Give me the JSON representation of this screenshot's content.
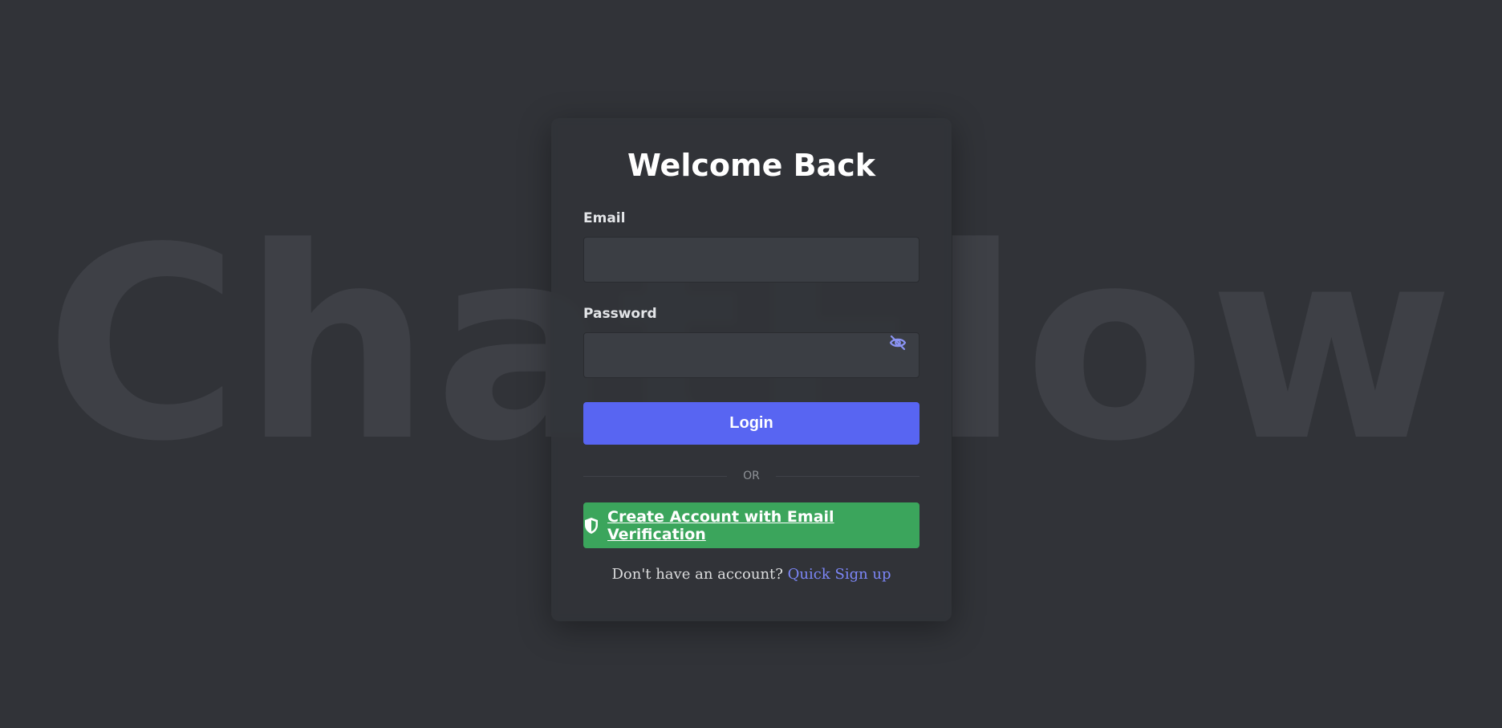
{
  "background": {
    "word": "ChatFlow"
  },
  "card": {
    "title": "Welcome Back"
  },
  "email": {
    "label": "Email",
    "value": "",
    "placeholder": ""
  },
  "password": {
    "label": "Password",
    "value": "",
    "placeholder": "",
    "toggle_icon": "eye-slash-icon"
  },
  "login_button": {
    "label": "Login"
  },
  "divider": {
    "text": "OR"
  },
  "verify_button": {
    "label": "Create Account with Email Verification",
    "icon": "shield-icon"
  },
  "signup": {
    "prompt": "Don't have an account?",
    "link": "Quick Sign up"
  },
  "colors": {
    "background": "#313338",
    "card": "#313338",
    "input": "#3b3e44",
    "primary": "#5865f2",
    "success": "#3ba55c",
    "link": "#7c86f7",
    "watermark": "#3e4046"
  }
}
